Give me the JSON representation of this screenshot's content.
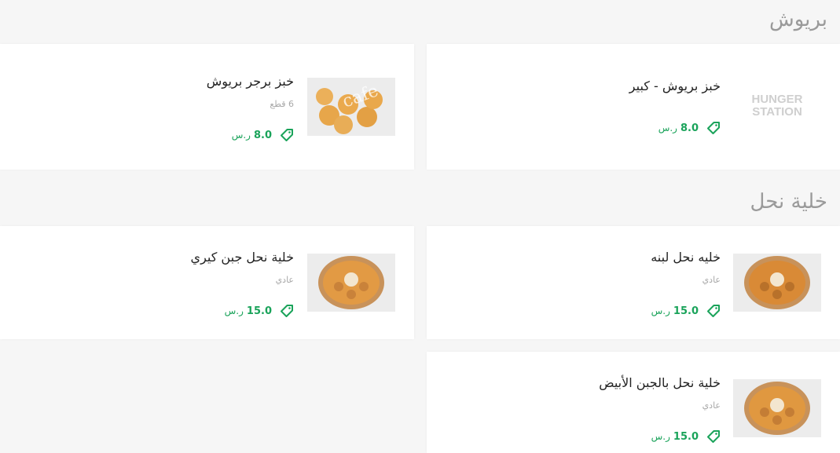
{
  "sections": [
    {
      "title": "بريوش",
      "items": [
        {
          "name": "خبز بريوش - كبير",
          "desc": "",
          "price": "8.0",
          "currency": "ر.س",
          "image": "hungerstation-logo"
        },
        {
          "name": "خبز برجر بريوش",
          "desc": "6 قطع",
          "price": "8.0",
          "currency": "ر.س",
          "image": "brioche-buns-photo"
        }
      ]
    },
    {
      "title": "خلية نحل",
      "items": [
        {
          "name": "خليه نحل لبنه",
          "desc": "عادي",
          "price": "15.0",
          "currency": "ر.س",
          "image": "honeycomb-bread-photo"
        },
        {
          "name": "خلية نحل جبن كيري",
          "desc": "عادي",
          "price": "15.0",
          "currency": "ر.س",
          "image": "honeycomb-bread-photo"
        },
        {
          "name": "خلية نحل بالجبن الأبيض",
          "desc": "عادي",
          "price": "15.0",
          "currency": "ر.س",
          "image": "honeycomb-bread-photo"
        }
      ]
    }
  ],
  "logo_placeholder": {
    "line1": "HUNGER",
    "line2": "STATION"
  },
  "watermark": "cafe",
  "colors": {
    "accent": "#1aa35a",
    "title": "#9a9a9a"
  }
}
